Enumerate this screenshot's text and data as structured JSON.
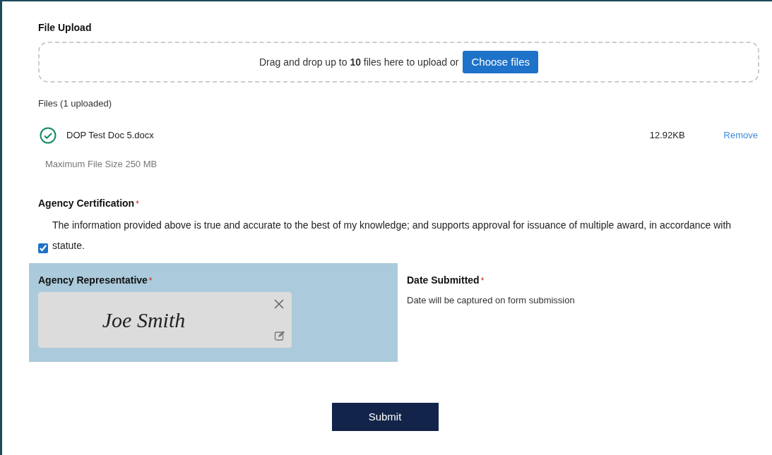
{
  "upload": {
    "title": "File Upload",
    "drop_text": "Drag and drop up to **10** files here to upload or",
    "choose_button": "Choose files",
    "files_heading": "Files (1 uploaded)",
    "files": [
      {
        "name": "DOP Test Doc 5.docx",
        "size": "12.92KB",
        "action": "Remove",
        "uploaded": true
      }
    ],
    "max_size": "Maximum File Size 250 MB"
  },
  "certification": {
    "title": "Agency Certification",
    "required": "*",
    "checked": true,
    "statement": "The information provided above is true and accurate to the best of my knowledge; and supports approval for issuance of multiple award, in accordance with statute."
  },
  "representative": {
    "label": "Agency Representative",
    "required": "*",
    "signature": "Joe Smith"
  },
  "date_submitted": {
    "label": "Date Submitted",
    "required": "*",
    "note": "Date will be captured on form submission"
  },
  "submit_button": "Submit"
}
